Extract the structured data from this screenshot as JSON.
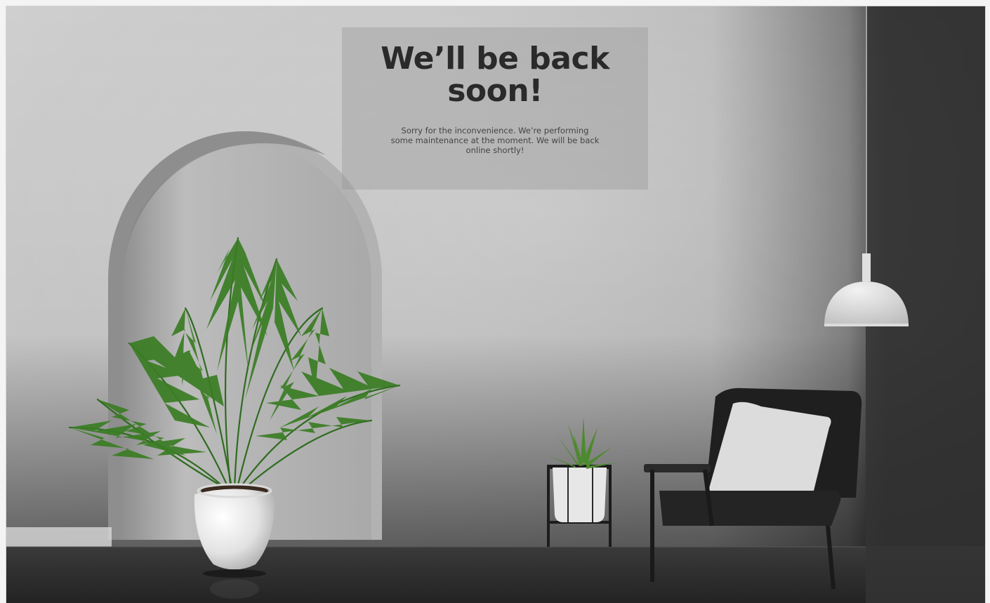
{
  "page": {
    "heading": "We’ll be back soon!",
    "message": "Sorry for the inconvenience. We’re performing some maintenance at the moment. We will be back online shortly!"
  },
  "scene": {
    "wall_color": "#c9c9c9",
    "floor_color": "#2b2b2b",
    "dark_wall_color": "#3a3a3a",
    "plant_color": "#2f6b1f",
    "pot_color": "#e6e6e6",
    "icons": [
      "potted-palm",
      "succulent-on-stand",
      "armchair",
      "pendant-lamp",
      "wall-arch"
    ]
  }
}
